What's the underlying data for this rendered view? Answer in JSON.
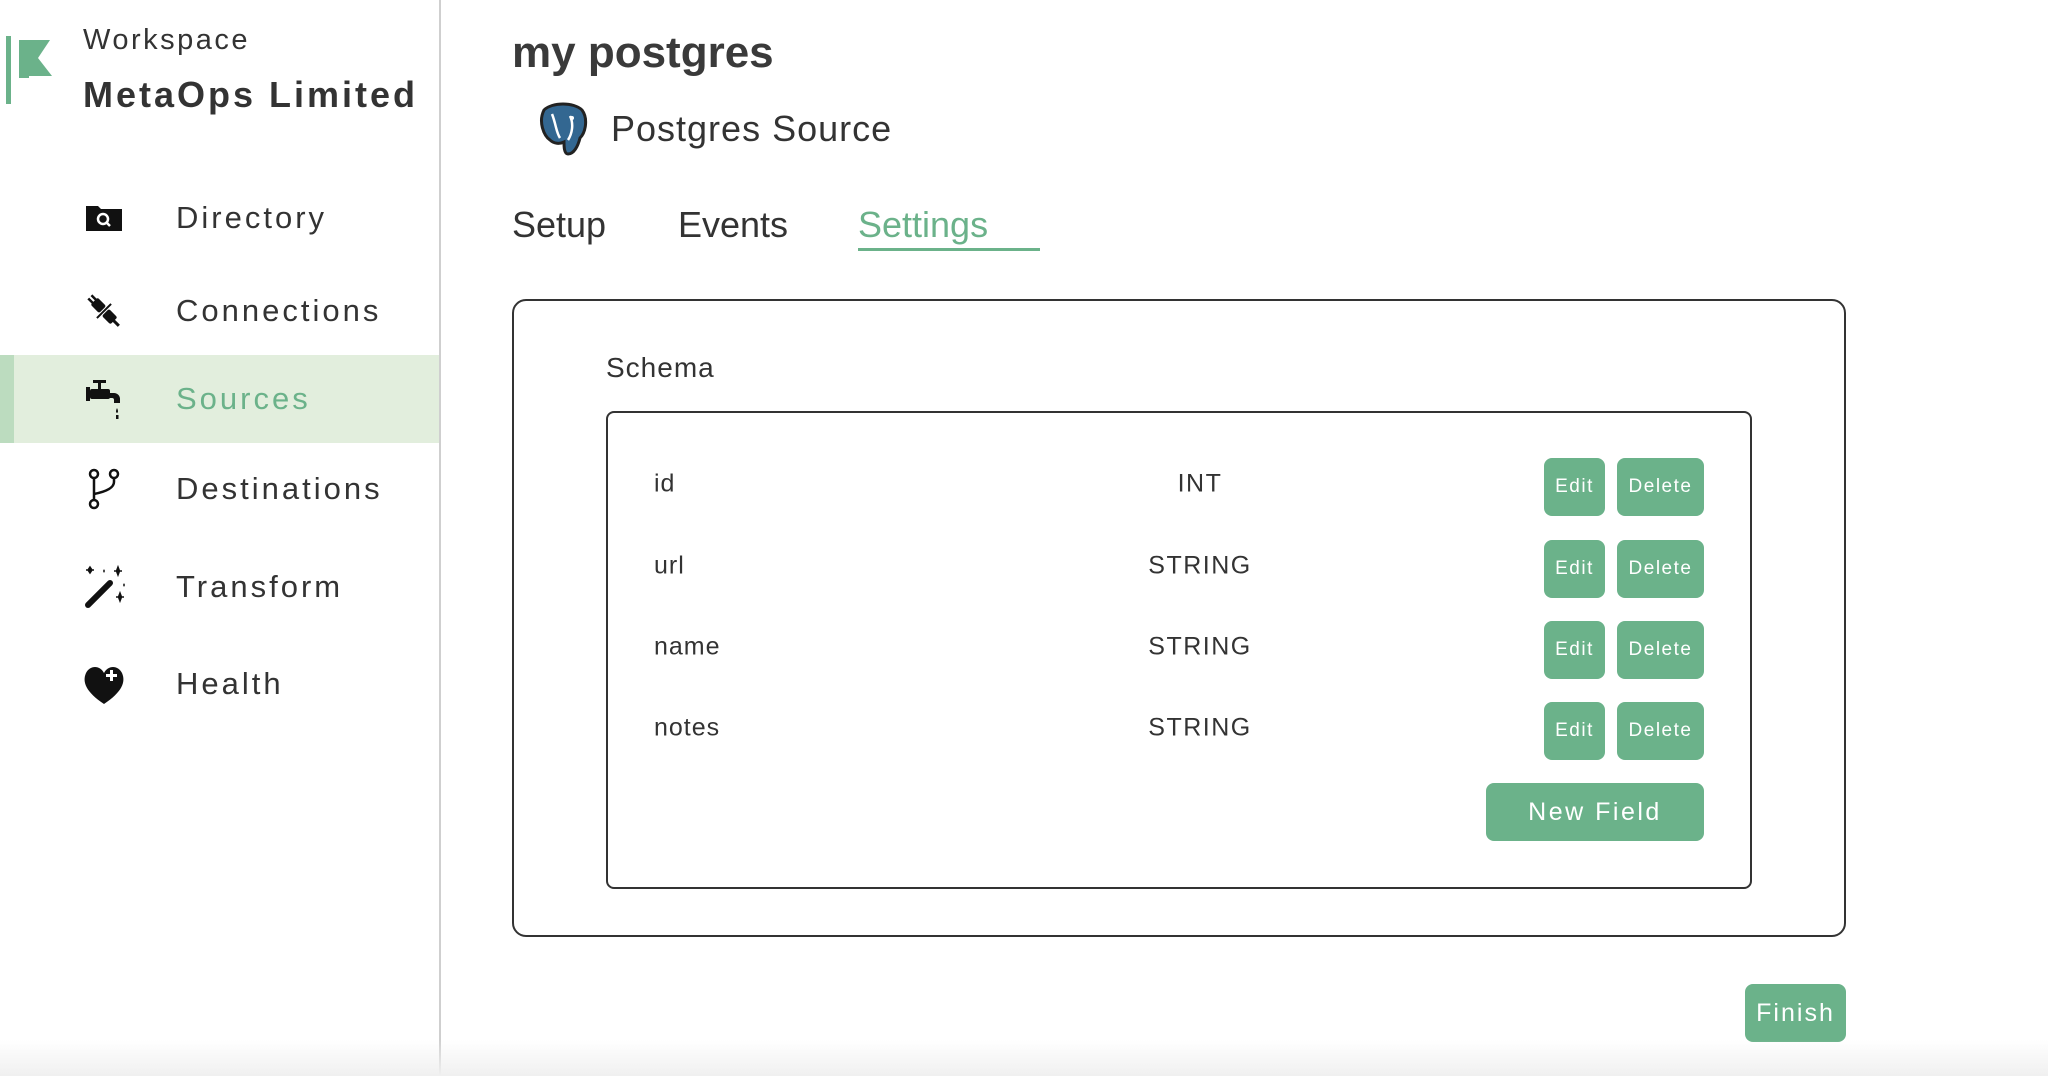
{
  "workspace": {
    "label": "Workspace",
    "name": "MetaOps Limited",
    "logo_icon": "flag-logo"
  },
  "sidebar": {
    "items": [
      {
        "label": "Directory",
        "icon": "folder-search-icon",
        "active": false
      },
      {
        "label": "Connections",
        "icon": "plug-icon",
        "active": false
      },
      {
        "label": "Sources",
        "icon": "faucet-icon",
        "active": true
      },
      {
        "label": "Destinations",
        "icon": "branch-icon",
        "active": false
      },
      {
        "label": "Transform",
        "icon": "magic-wand-icon",
        "active": false
      },
      {
        "label": "Health",
        "icon": "heart-plus-icon",
        "active": false
      }
    ]
  },
  "main": {
    "title": "my postgres",
    "source": {
      "name": "Postgres Source",
      "icon": "postgres-elephant-icon"
    },
    "tabs": [
      {
        "label": "Setup",
        "active": false
      },
      {
        "label": "Events",
        "active": false
      },
      {
        "label": "Settings",
        "active": true
      }
    ],
    "schema": {
      "label": "Schema",
      "fields": [
        {
          "name": "id",
          "type": "INT"
        },
        {
          "name": "url",
          "type": "STRING"
        },
        {
          "name": "name",
          "type": "STRING"
        },
        {
          "name": "notes",
          "type": "STRING"
        }
      ],
      "edit_label": "Edit",
      "delete_label": "Delete",
      "new_field_label": "New Field"
    },
    "finish_label": "Finish"
  },
  "colors": {
    "accent": "#6bb28a",
    "active_bg": "#e2eedd",
    "text": "#333333"
  }
}
